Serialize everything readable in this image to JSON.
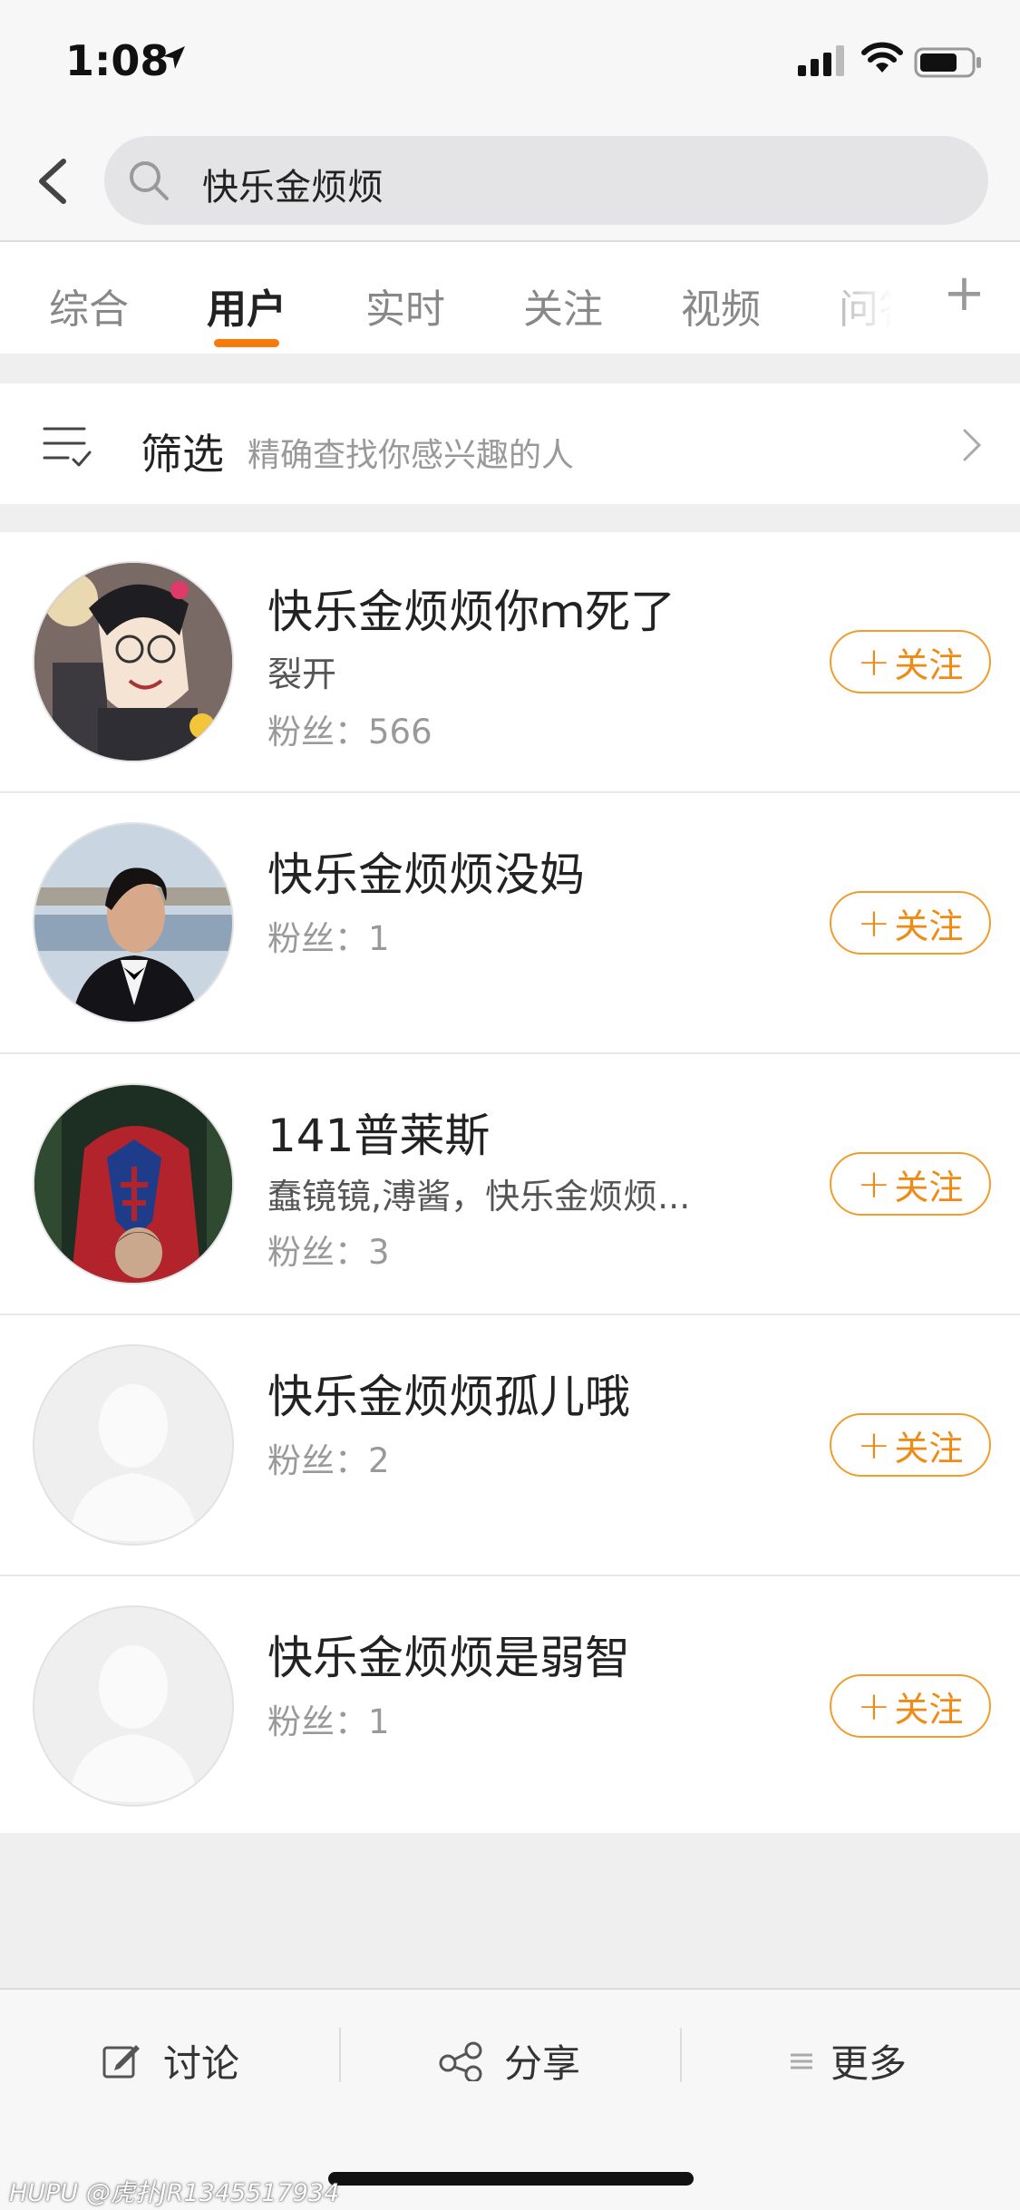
{
  "status_bar": {
    "time": "1:08"
  },
  "search": {
    "query": "快乐金烦烦"
  },
  "tabs": [
    {
      "label": "综合",
      "active": false
    },
    {
      "label": "用户",
      "active": true
    },
    {
      "label": "实时",
      "active": false
    },
    {
      "label": "关注",
      "active": false
    },
    {
      "label": "视频",
      "active": false
    },
    {
      "label": "问答",
      "active": false
    }
  ],
  "filter": {
    "label": "筛选",
    "hint": "精确查找你感兴趣的人"
  },
  "users": [
    {
      "name": "快乐金烦烦你ｍ死了",
      "desc": "裂开",
      "fans_label": "粉丝：",
      "fans": "566",
      "follow_label": "关注",
      "avatar_icon": "anime-girl-avatar"
    },
    {
      "name": "快乐金烦烦没妈",
      "desc": "",
      "fans_label": "粉丝：",
      "fans": "1",
      "follow_label": "关注",
      "avatar_icon": "man-in-tuxedo-avatar"
    },
    {
      "name": "141普莱斯",
      "desc": "蠢镜镜,溥酱，快乐金烦烦...",
      "fans_label": "粉丝：",
      "fans": "3",
      "follow_label": "关注",
      "avatar_icon": "spiderman-avatar"
    },
    {
      "name": "快乐金烦烦孤儿哦",
      "desc": "",
      "fans_label": "粉丝：",
      "fans": "2",
      "follow_label": "关注",
      "avatar_icon": "default-person-avatar"
    },
    {
      "name": "快乐金烦烦是弱智",
      "desc": "",
      "fans_label": "粉丝：",
      "fans": "1",
      "follow_label": "关注",
      "avatar_icon": "default-person-avatar"
    }
  ],
  "bottom_bar": {
    "discuss": "讨论",
    "share": "分享",
    "more": "更多"
  },
  "watermark": "HUPU @虎扑JR1345517934",
  "colors": {
    "accent": "#f77b0a",
    "follow_border": "#f39c2c"
  }
}
